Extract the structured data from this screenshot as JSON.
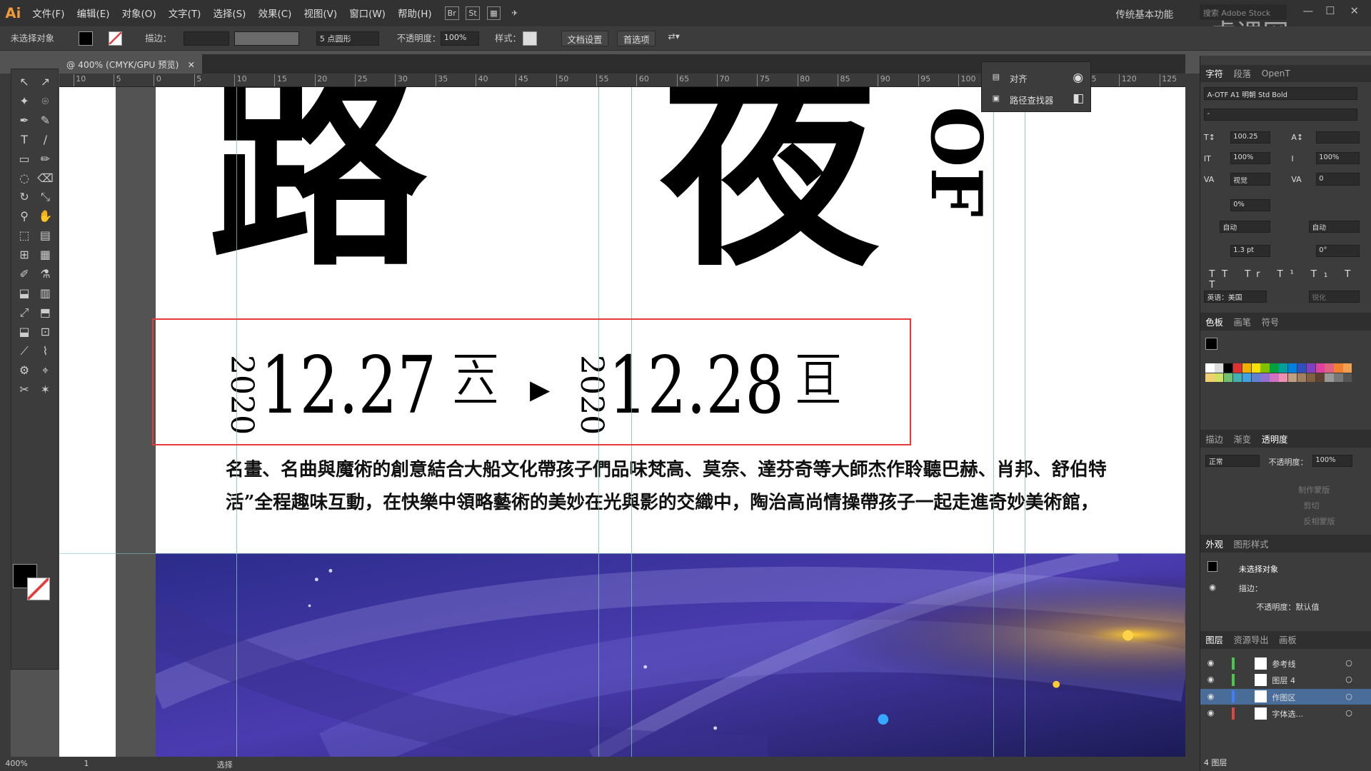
{
  "app": {
    "logo": "Ai",
    "menus": [
      "文件(F)",
      "编辑(E)",
      "对象(O)",
      "文字(T)",
      "选择(S)",
      "效果(C)",
      "视图(V)",
      "窗口(W)",
      "帮助(H)"
    ],
    "workspace": "传统基本功能",
    "stock_placeholder": "搜索 Adobe Stock",
    "watermark": "虎课网"
  },
  "control": {
    "selection": "未选择对象",
    "stroke_label": "描边：",
    "brush": "5 点圆形",
    "opacity_label": "不透明度：",
    "opacity_value": "100%",
    "style_label": "样式：",
    "doc_setup": "文档设置",
    "prefs": "首选项"
  },
  "document": {
    "tab": "@ 400% (CMYK/GPU 预览)"
  },
  "ruler": {
    "marks": [
      "10",
      "5",
      "0",
      "5",
      "10",
      "15",
      "20",
      "25",
      "30",
      "35",
      "40",
      "45",
      "50",
      "55",
      "60",
      "65",
      "70",
      "75",
      "80",
      "85",
      "90",
      "95",
      "100",
      "105",
      "110",
      "115",
      "120",
      "125"
    ]
  },
  "floating": {
    "align": "对齐",
    "pathfinder": "路径查找器"
  },
  "artboard": {
    "title_chars": "路 夜",
    "of_text": "OF",
    "year1": "2020",
    "date1": "12.27",
    "weekday1": "六",
    "year2": "2020",
    "date2": "12.28",
    "weekday2": "日",
    "para1": "名畫、名曲與魔術的創意結合大船文化帶孩子們品味梵高、莫奈、達芬奇等大師杰作聆聽巴赫、肖邦、舒伯特",
    "para2": "活”全程趣味互動，在快樂中領略藝術的美妙在光與影的交織中，陶治高尚情操帶孩子一起走進奇妙美術館，"
  },
  "char_panel": {
    "tabs": [
      "字符",
      "段落",
      "OpenT"
    ],
    "font": "A-OTF A1 明朝 Std Bold",
    "style": "-",
    "size": "100.25",
    "leading": "",
    "vscale": "100%",
    "hscale": "100%",
    "kerning": "视觉",
    "tracking": "0",
    "tsume": "0%",
    "aki_left": "自动",
    "aki_right": "自动",
    "baseline": "1.3 pt",
    "rotate": "0°",
    "language": "英语：美国",
    "aa": "锐化"
  },
  "color_panel": {
    "tabs": [
      "色板",
      "画笔",
      "符号"
    ]
  },
  "transp_panel": {
    "tabs": [
      "描边",
      "渐变",
      "透明度"
    ],
    "mode": "正常",
    "opacity_label": "不透明度：",
    "opacity": "100%",
    "make_mask": "制作蒙版",
    "clip": "剪切",
    "invert": "反相蒙版"
  },
  "appearance": {
    "tabs": [
      "外观",
      "图形样式"
    ],
    "title": "未选择对象",
    "stroke": "描边：",
    "opacity": "不透明度：默认值"
  },
  "layers": {
    "tabs": [
      "图层",
      "资源导出",
      "画板"
    ],
    "items": [
      {
        "name": "参考线",
        "color": "#49c949"
      },
      {
        "name": "图层 4",
        "color": "#49c949"
      },
      {
        "name": "作图区",
        "color": "#3d7fff"
      },
      {
        "name": "字体选...",
        "color": "#e04545"
      }
    ],
    "count": "4 图层"
  },
  "status": {
    "zoom": "400%",
    "page": "1",
    "tool": "选择"
  },
  "colors": {
    "accent_red": "#e53b3b",
    "panel": "#3c3c3c",
    "guide": "#7fbfb8"
  }
}
